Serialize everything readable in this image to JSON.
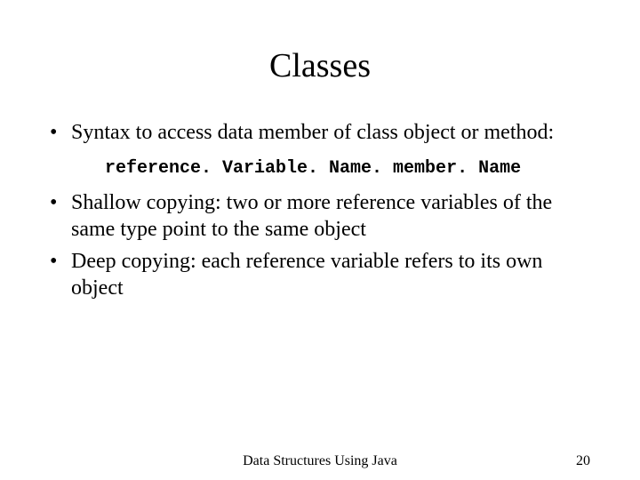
{
  "slide": {
    "title": "Classes",
    "bullets": [
      "Syntax to access data member of class object or method:",
      "Shallow copying: two or more reference variables of the same type point to the same object",
      "Deep copying: each reference variable refers to its own object"
    ],
    "code_line": "reference. Variable. Name. member. Name",
    "footer_center": "Data Structures Using Java",
    "footer_page": "20"
  }
}
